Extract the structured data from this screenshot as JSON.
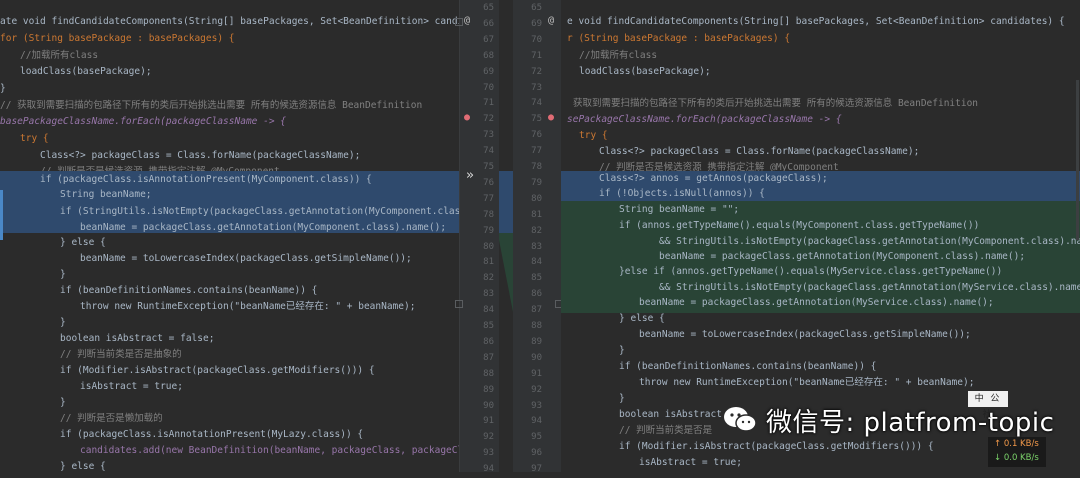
{
  "left_code": {
    "l1": "ate void findCandidateComponents(String[] basePackages, Set<BeanDefinition> candidates) {",
    "l2": "for (String basePackage : basePackages) {",
    "l3": "//加载所有class",
    "l4": "loadClass(basePackage);",
    "l5": "}",
    "l6": "// 获取到需要扫描的包路径下所有的类后开始挑选出需要 所有的候选资源信息 BeanDefinition",
    "l7": "basePackageClassName.forEach(packageClassName -> {",
    "l8": "try {",
    "l9": "Class<?> packageClass = Class.forName(packageClassName);",
    "l10": "// 判断是否是候选资源 携带指定注解 @MyComponent",
    "l11": "if (packageClass.isAnnotationPresent(MyComponent.class)) {",
    "l12": "String beanName;",
    "l13": "if (StringUtils.isNotEmpty(packageClass.getAnnotation(MyComponent.class).name(",
    "l14": "beanName = packageClass.getAnnotation(MyComponent.class).name();",
    "l15": "} else {",
    "l16": "beanName = toLowercaseIndex(packageClass.getSimpleName());",
    "l17": "}",
    "l18": "if (beanDefinitionNames.contains(beanName)) {",
    "l19": "throw new RuntimeException(\"beanName已经存在: \" + beanName);",
    "l20": "}",
    "l21": "boolean isAbstract = false;",
    "l22": "// 判断当前类是否是抽象的",
    "l23": "if (Modifier.isAbstract(packageClass.getModifiers())) {",
    "l24": "isAbstract = true;",
    "l25": "}",
    "l26": "// 判断是否是懒加载的",
    "l27": "if (packageClass.isAnnotationPresent(MyLazy.class)) {",
    "l28": "candidates.add(new BeanDefinition(beanName, packageClass, packageClassName",
    "l29": "} else {"
  },
  "right_code": {
    "r1": "e void findCandidateComponents(String[] basePackages, Set<BeanDefinition> candidates) {",
    "r2": "r (String basePackage : basePackages) {",
    "r3": "//加载所有class",
    "r4": "loadClass(basePackage);",
    "r5": "",
    "r6": "获取到需要扫描的包路径下所有的类后开始挑选出需要 所有的候选资源信息 BeanDefinition",
    "r7": "sePackageClassName.forEach(packageClassName -> {",
    "r8": "try {",
    "r9": "Class<?> packageClass = Class.forName(packageClassName);",
    "r10": "// 判断是否是候选资源 携带指定注解 @MyComponent",
    "r11": "Class<?> annos = getAnnos(packageClass);",
    "r12": "if (!Objects.isNull(annos)) {",
    "r13": "String beanName = \"\";",
    "r14": "if (annos.getTypeName().equals(MyComponent.class.getTypeName())",
    "r15": "&& StringUtils.isNotEmpty(packageClass.getAnnotation(MyComponent.class).name())){",
    "r16": "beanName = packageClass.getAnnotation(MyComponent.class).name();",
    "r17": "}else if (annos.getTypeName().equals(MyService.class.getTypeName())",
    "r18": "&& StringUtils.isNotEmpty(packageClass.getAnnotation(MyService.class).name())){",
    "r19": "beanName = packageClass.getAnnotation(MyService.class).name();",
    "r20": "} else {",
    "r21": "beanName = toLowercaseIndex(packageClass.getSimpleName());",
    "r22": "}",
    "r23": "if (beanDefinitionNames.contains(beanName)) {",
    "r24": "throw new RuntimeException(\"beanName已经存在: \" + beanName);",
    "r25": "}",
    "r26": "boolean isAbstract",
    "r27": "// 判断当前类是否是",
    "r28": "if (Modifier.isAbstract(packageClass.getModifiers())) {",
    "r29": "isAbstract = true;"
  },
  "gutter_left": [
    "65",
    "66",
    "67",
    "68",
    "69",
    "70",
    "71",
    "72",
    "73",
    "74",
    "75",
    "76",
    "77",
    "78",
    "79",
    "80",
    "81",
    "82",
    "83",
    "84",
    "85",
    "86",
    "87",
    "88",
    "89",
    "90",
    "91",
    "92",
    "93",
    "94"
  ],
  "gutter_right": [
    "65",
    "69",
    "70",
    "71",
    "72",
    "73",
    "74",
    "75",
    "76",
    "77",
    "78",
    "79",
    "80",
    "81",
    "82",
    "83",
    "84",
    "85",
    "86",
    "87",
    "88",
    "89",
    "90",
    "91",
    "92",
    "93",
    "94",
    "95",
    "96",
    "97"
  ],
  "diff_arrow": "»",
  "watermark": {
    "text": "微信号: platfrom-topic",
    "stamp": "中 公 社"
  },
  "network": {
    "upload": "0.1 KB/s",
    "download": "0.0 KB/s"
  },
  "colors": {
    "background": "#2b2b2b",
    "gutter": "#313335",
    "changed_line": "#2f4a6d",
    "added_line": "#294436",
    "keyword": "#cc7832",
    "comment": "#808080",
    "string": "#6a8759",
    "field": "#9876aa"
  }
}
